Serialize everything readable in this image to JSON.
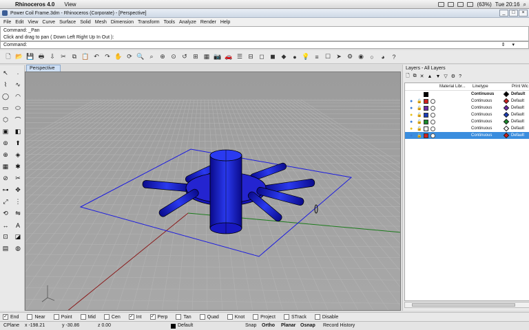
{
  "mac_menubar": {
    "app_name": "Rhinoceros 4.0",
    "menu": "View",
    "battery": "(63%)",
    "clock": "Tue 20:16"
  },
  "window": {
    "title": "Power Coil Frame.3dm - Rhinoceros (Corporate) - [Perspective]"
  },
  "menu": [
    "File",
    "Edit",
    "View",
    "Curve",
    "Surface",
    "Solid",
    "Mesh",
    "Dimension",
    "Transform",
    "Tools",
    "Analyze",
    "Render",
    "Help"
  ],
  "command_history": [
    "Command: _Pan",
    "Click and drag to pan ( Down  Left  Right  Up  In  Out ):"
  ],
  "command_prompt": "Command:",
  "toolbar_icons": [
    "new-icon",
    "open-icon",
    "save-icon",
    "print-icon",
    "import-icon",
    "cut-icon",
    "copy-icon",
    "paste-icon",
    "undo-icon",
    "redo-icon",
    "pan-icon",
    "rotate-view-icon",
    "zoom-dynamic-icon",
    "zoom-window-icon",
    "zoom-extents-icon",
    "zoom-selected-icon",
    "undo-view-icon",
    "four-views-icon",
    "grid-icon",
    "camera-icon",
    "car-icon",
    "named-views-icon",
    "viewport-layout-icon",
    "wireframe-icon",
    "shaded-icon",
    "rendered-icon",
    "material-icon",
    "light-icon",
    "layer-icon",
    "properties-icon",
    "select-icon",
    "options-icon",
    "render-icon",
    "sphere-icon",
    "color-icon",
    "help-icon"
  ],
  "left_tools": [
    "select-arrow-icon",
    "point-icon",
    "polyline-icon",
    "curve-icon",
    "circle-icon",
    "arc-icon",
    "rectangle-icon",
    "ellipse-icon",
    "polygon-icon",
    "fillet-icon",
    "box-icon",
    "surface-icon",
    "cylinder-icon",
    "extrude-icon",
    "boolean-icon",
    "solid-tools-icon",
    "mesh-icon",
    "explode-icon",
    "split-icon",
    "trim-icon",
    "join-icon",
    "move-icon",
    "scale-icon",
    "array-icon",
    "rotate-icon",
    "mirror-icon",
    "dimension-icon",
    "text-icon",
    "group-icon",
    "analyze-icon",
    "block-icon",
    "render-tool-icon"
  ],
  "viewport": {
    "label": "Perspective"
  },
  "layers": {
    "title": "Layers - All Layers",
    "columns": {
      "material": "Material Libr...",
      "linetype": "Linetype",
      "print_width": "Print Wic"
    },
    "header_row": {
      "linetype": "Continuous",
      "print_width": "Default"
    },
    "rows": [
      {
        "color": "#d02020",
        "linetype": "Continuous",
        "print_width": "Default",
        "selected": false,
        "bulb": "#3a7bd5"
      },
      {
        "color": "#6a2aa8",
        "linetype": "Continuous",
        "print_width": "Default",
        "selected": false,
        "bulb": "#3a7bd5"
      },
      {
        "color": "#1a3db8",
        "linetype": "Continuous",
        "print_width": "Default",
        "selected": false,
        "bulb": "#e8c21a"
      },
      {
        "color": "#1a8a2a",
        "linetype": "Continuous",
        "print_width": "Default",
        "selected": false,
        "bulb": "#3a7bd5"
      },
      {
        "color": "#ffffff",
        "linetype": "Continuous",
        "print_width": "Default",
        "selected": false,
        "bulb": "#e8c21a"
      },
      {
        "color": "#d02020",
        "linetype": "Continuous",
        "print_width": "Default",
        "selected": true,
        "bulb": "#3a7bd5"
      }
    ]
  },
  "osnap": [
    {
      "label": "End",
      "checked": true
    },
    {
      "label": "Near",
      "checked": false
    },
    {
      "label": "Point",
      "checked": false
    },
    {
      "label": "Mid",
      "checked": false
    },
    {
      "label": "Cen",
      "checked": false
    },
    {
      "label": "Int",
      "checked": true
    },
    {
      "label": "Perp",
      "checked": true
    },
    {
      "label": "Tan",
      "checked": false
    },
    {
      "label": "Quad",
      "checked": false
    },
    {
      "label": "Knot",
      "checked": false
    },
    {
      "label": "Project",
      "checked": false
    },
    {
      "label": "STrack",
      "checked": false
    },
    {
      "label": "Disable",
      "checked": false
    }
  ],
  "status": {
    "cplane": "CPlane",
    "x": "x -198.21",
    "y": "y -30.86",
    "z": "z 0.00",
    "layer": "Default",
    "snap": "Snap",
    "ortho": "Ortho",
    "planar": "Planar",
    "osnap": "Osnap",
    "record": "Record History"
  }
}
